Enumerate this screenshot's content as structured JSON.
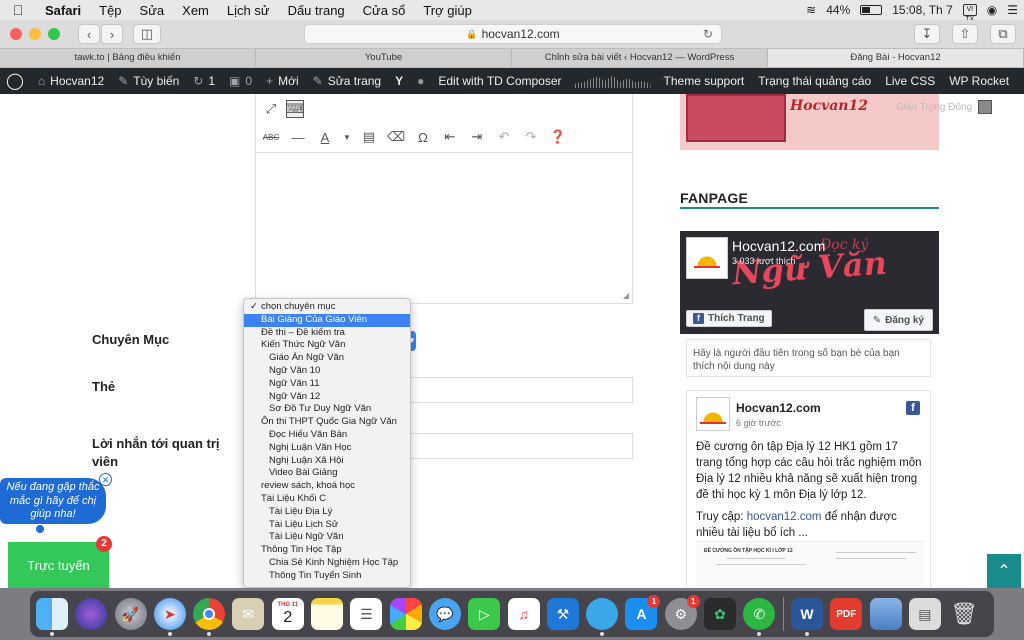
{
  "menubar": {
    "items": [
      "Safari",
      "Tệp",
      "Sửa",
      "Xem",
      "Lịch sử",
      "Dấu trang",
      "Cửa sổ",
      "Trợ giúp"
    ],
    "battery": "44%",
    "clock": "15:08, Th 7",
    "input_badge": "VI TX"
  },
  "toolbar": {
    "url": "hocvan12.com"
  },
  "tabs": [
    {
      "label": "tawk.to | Bảng điều khiển"
    },
    {
      "label": "YouTube"
    },
    {
      "label": "Chỉnh sửa bài viết ‹ Hocvan12 — WordPress"
    },
    {
      "label": "Đăng Bài - Hocvan12"
    }
  ],
  "wpbar": {
    "site": "Hocvan12",
    "customize": "Tùy biến",
    "updates": "1",
    "comments": "0",
    "new": "Mới",
    "edit_page": "Sửa trang",
    "td_composer": "Edit with TD Composer",
    "theme_support": "Theme support",
    "ads_status": "Trạng thái quảng cáo",
    "live_css": "Live CSS",
    "wp_rocket": "WP Rocket"
  },
  "form": {
    "category_label": "Chuyên Mục",
    "tags_label": "Thẻ",
    "message_label": "Lời nhắn tới quan trị viên"
  },
  "dropdown": {
    "options": [
      {
        "label": "chọn chuyên mục",
        "level": 0,
        "checked": true,
        "selected": false
      },
      {
        "label": "Bài Giảng Của Giáo Viên",
        "level": 0,
        "checked": false,
        "selected": true
      },
      {
        "label": "Đề thi – Đề kiểm tra",
        "level": 0,
        "checked": false,
        "selected": false
      },
      {
        "label": "Kiến Thức Ngữ Văn",
        "level": 0,
        "checked": false,
        "selected": false
      },
      {
        "label": "Giáo Án Ngữ Văn",
        "level": 1,
        "checked": false,
        "selected": false
      },
      {
        "label": "Ngữ Văn 10",
        "level": 1,
        "checked": false,
        "selected": false
      },
      {
        "label": "Ngữ Văn 11",
        "level": 1,
        "checked": false,
        "selected": false
      },
      {
        "label": "Ngữ Văn 12",
        "level": 1,
        "checked": false,
        "selected": false
      },
      {
        "label": "Sơ Đồ Tư Duy Ngữ Văn",
        "level": 1,
        "checked": false,
        "selected": false
      },
      {
        "label": "Ôn thi THPT Quốc Gia Ngữ Văn",
        "level": 0,
        "checked": false,
        "selected": false
      },
      {
        "label": "Đọc Hiểu Văn Bản",
        "level": 1,
        "checked": false,
        "selected": false
      },
      {
        "label": "Nghị Luận Văn Học",
        "level": 1,
        "checked": false,
        "selected": false
      },
      {
        "label": "Nghị Luận Xã Hội",
        "level": 1,
        "checked": false,
        "selected": false
      },
      {
        "label": "Video Bài Giảng",
        "level": 1,
        "checked": false,
        "selected": false
      },
      {
        "label": "review sách, khoá học",
        "level": 0,
        "checked": false,
        "selected": false
      },
      {
        "label": "Tài Liệu Khối C",
        "level": 0,
        "checked": false,
        "selected": false
      },
      {
        "label": "Tài Liệu Địa Lý",
        "level": 1,
        "checked": false,
        "selected": false
      },
      {
        "label": "Tài Liệu Lịch Sử",
        "level": 1,
        "checked": false,
        "selected": false
      },
      {
        "label": "Tài Liệu Ngữ Văn",
        "level": 1,
        "checked": false,
        "selected": false
      },
      {
        "label": "Thông Tin Học Tập",
        "level": 0,
        "checked": false,
        "selected": false
      },
      {
        "label": "Chia Sẻ Kinh Nghiệm Học Tập",
        "level": 1,
        "checked": false,
        "selected": false
      },
      {
        "label": "Thông Tin Tuyển Sinh",
        "level": 1,
        "checked": false,
        "selected": false
      }
    ]
  },
  "sidebar": {
    "banner_title": "Hocvan12",
    "banner_byline": "Giáo Trọng Đông",
    "fanpage_title": "FANPAGE",
    "fb_page_name": "Hocvan12.com",
    "fb_likes": "3.033 lượt thích",
    "fb_like_btn": "Thích Trang",
    "fb_register_btn": "Đăng ký",
    "fb_cover_art": "Ngữ Văn",
    "friends_note": "Hãy là người đầu tiên trong số bạn bè của bạn thích nội dung này",
    "post_name": "Hocvan12.com",
    "post_time": "6 giờ trước",
    "post_text": "Đề cương ôn tập Địa lý 12 HK1 gồm 17 trang tổng hợp các câu hỏi trắc nghiệm môn Địa lý 12 nhiều khả năng sẽ xuất hiện trong đề thi học kỳ 1 môn Địa lý lớp 12.",
    "post_cta_prefix": "Truy cập: ",
    "post_cta_link": "hocvan12.com",
    "post_cta_suffix": " để nhận được nhiều tài liệu bổ ích ...",
    "thumb_title": "ĐỀ CƯƠNG ÔN TẬP HỌC KÌ I LỚP 12"
  },
  "chat": {
    "bubble": "Nếu đang gặp thắc mắc gì hãy để chị giúp nha!",
    "online": "Trực tuyến",
    "badge": "2"
  },
  "dock": {
    "calendar_month": "THG 11",
    "calendar_day": "2",
    "appstore_badge": "1",
    "prefs_badge": "1",
    "pdf_label": "PDF",
    "word_label": "W"
  }
}
